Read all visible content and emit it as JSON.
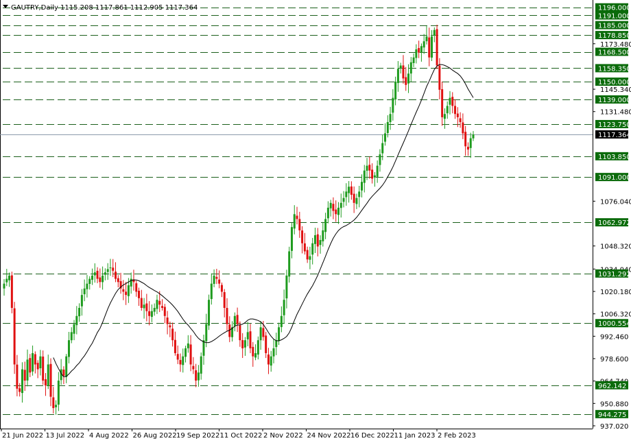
{
  "header": {
    "symbol": "GAUTRY,Daily",
    "ohlc": "1115.208 1117.861 1112.905 1117.364"
  },
  "colors": {
    "background": "#ffffff",
    "bull": "#1e9b1e",
    "bear": "#e01010",
    "ma": "#000000",
    "level_line": "#1a5e1a",
    "level_tag": "#0b6b0b",
    "price_tag": "#000000"
  },
  "chart_data": {
    "type": "candlestick",
    "y_range": [
      937.0,
      1198.0
    ],
    "grid": false,
    "date_labels": [
      "21 Jun 2022",
      "13 Jul 2022",
      "4 Aug 2022",
      "26 Aug 2022",
      "19 Sep 2022",
      "11 Oct 2022",
      "2 Nov 2022",
      "24 Nov 2022",
      "16 Dec 2022",
      "11 Jan 2023",
      "2 Feb 2023"
    ],
    "price_ticks": [
      "1173.480",
      "1145.340",
      "1131.480",
      "1076.040",
      "1048.320",
      "1034.040",
      "1020.180",
      "1006.320",
      "992.460",
      "978.600",
      "964.740",
      "950.880",
      "937.020"
    ],
    "levels": [
      {
        "label": "1196.000",
        "value": 1196.0
      },
      {
        "label": "1191.000",
        "value": 1191.0
      },
      {
        "label": "1185.000",
        "value": 1185.0
      },
      {
        "label": "1178.850",
        "value": 1178.85
      },
      {
        "label": "1168.500",
        "value": 1168.5
      },
      {
        "label": "1158.350",
        "value": 1158.35
      },
      {
        "label": "1150.000",
        "value": 1150.0
      },
      {
        "label": "1139.000",
        "value": 1139.0
      },
      {
        "label": "1123.750",
        "value": 1123.75
      },
      {
        "label": "1103.850",
        "value": 1103.85
      },
      {
        "label": "1091.000",
        "value": 1091.0
      },
      {
        "label": "1062.972",
        "value": 1062.972
      },
      {
        "label": "1031.292",
        "value": 1031.292
      },
      {
        "label": "1000.554",
        "value": 1000.554
      },
      {
        "label": "962.142",
        "value": 962.142
      },
      {
        "label": "944.275",
        "value": 944.275
      }
    ],
    "current_price": {
      "label": "1117.364",
      "value": 1117.364
    },
    "closes": [
      1025,
      1028,
      1030,
      1010,
      975,
      960,
      958,
      972,
      965,
      978,
      970,
      982,
      975,
      972,
      980,
      965,
      962,
      975,
      955,
      948,
      950,
      965,
      972,
      968,
      980,
      990,
      995,
      1000,
      1005,
      1010,
      1018,
      1022,
      1025,
      1028,
      1030,
      1032,
      1028,
      1026,
      1030,
      1032,
      1034,
      1035,
      1033,
      1028,
      1026,
      1022,
      1020,
      1018,
      1024,
      1028,
      1026,
      1020,
      1016,
      1010,
      1012,
      1008,
      1005,
      1008,
      1010,
      1015,
      1012,
      1010,
      1005,
      1000,
      998,
      990,
      982,
      978,
      975,
      980,
      985,
      988,
      975,
      972,
      965,
      970,
      980,
      990,
      1000,
      1015,
      1025,
      1030,
      1028,
      1025,
      1020,
      1010,
      1000,
      992,
      998,
      1005,
      1000,
      990,
      985,
      990,
      995,
      985,
      980,
      982,
      990,
      998,
      992,
      982,
      975,
      980,
      985,
      990,
      998,
      1005,
      1015,
      1030,
      1045,
      1060,
      1068,
      1065,
      1058,
      1050,
      1045,
      1040,
      1042,
      1050,
      1055,
      1048,
      1052,
      1058,
      1065,
      1072,
      1075,
      1070,
      1068,
      1072,
      1075,
      1078,
      1082,
      1085,
      1080,
      1075,
      1078,
      1082,
      1088,
      1095,
      1098,
      1095,
      1090,
      1092,
      1098,
      1105,
      1112,
      1118,
      1125,
      1130,
      1140,
      1150,
      1158,
      1160,
      1152,
      1148,
      1155,
      1162,
      1165,
      1170,
      1168,
      1172,
      1175,
      1178,
      1165,
      1178,
      1182,
      1160,
      1145,
      1128,
      1130,
      1135,
      1140,
      1135,
      1130,
      1128,
      1125,
      1118,
      1110,
      1108,
      1115,
      1117.364
    ],
    "ma_period": 20
  }
}
